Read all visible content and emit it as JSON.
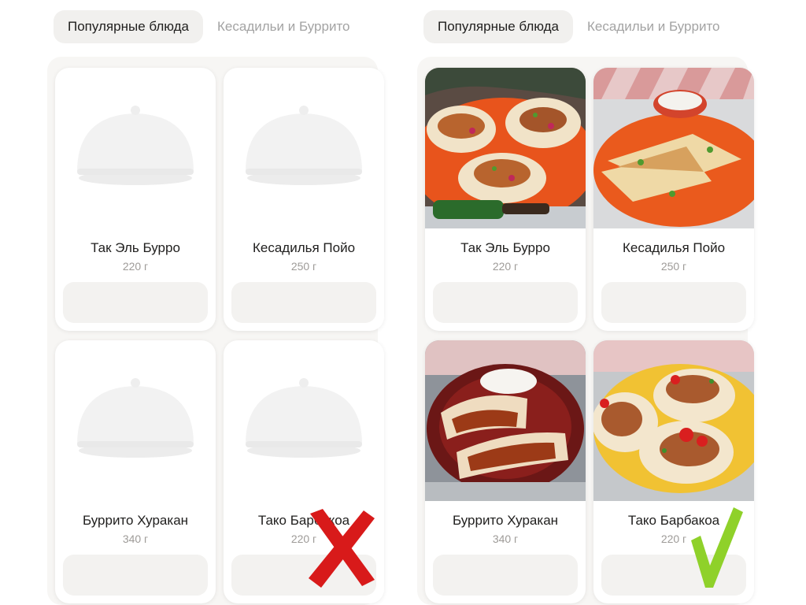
{
  "colors": {
    "accent_red": "#d81a1a",
    "accent_green": "#8fd12a",
    "tab_active_bg": "#f1f0ee",
    "button_bg": "#f3f2f0"
  },
  "left_panel": {
    "tabs": [
      {
        "label": "Популярные блюда",
        "active": true
      },
      {
        "label": "Кесадильи и Буррито",
        "active": false
      }
    ],
    "items": [
      {
        "name": "Так Эль Бурро",
        "weight": "220 г",
        "image": "dish-cover-placeholder"
      },
      {
        "name": "Кесадилья Пойо",
        "weight": "250 г",
        "image": "dish-cover-placeholder"
      },
      {
        "name": "Буррито Хуракан",
        "weight": "340 г",
        "image": "dish-cover-placeholder"
      },
      {
        "name": "Тако Барбакоа",
        "weight": "220 г",
        "image": "dish-cover-placeholder"
      }
    ],
    "verdict_icon": "red-cross"
  },
  "right_panel": {
    "tabs": [
      {
        "label": "Популярные блюда",
        "active": true
      },
      {
        "label": "Кесадильи и Буррито",
        "active": false
      }
    ],
    "items": [
      {
        "name": "Так Эль Бурро",
        "weight": "220 г",
        "image": "tacos-photo"
      },
      {
        "name": "Кесадилья Пойо",
        "weight": "250 г",
        "image": "quesadilla-photo"
      },
      {
        "name": "Буррито Хуракан",
        "weight": "340 г",
        "image": "burrito-photo"
      },
      {
        "name": "Тако Барбакоа",
        "weight": "220 г",
        "image": "taco-barbacoa-photo"
      }
    ],
    "verdict_icon": "green-check"
  }
}
